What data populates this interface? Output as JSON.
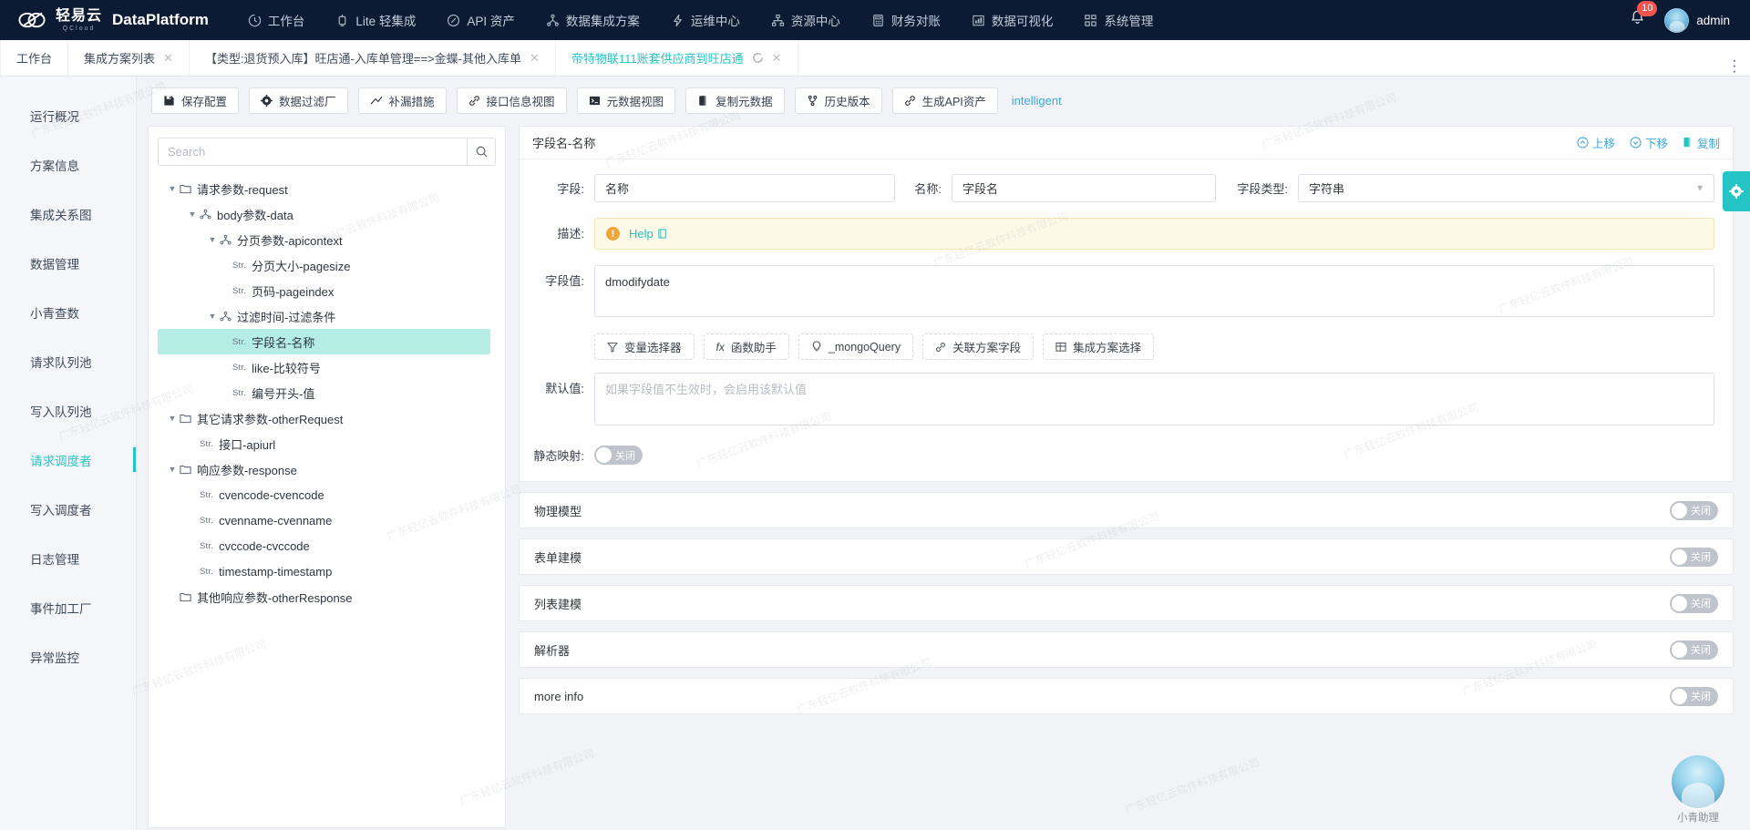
{
  "topnav": {
    "brand_cn": "轻易云",
    "brand_cn_sub": "QCloud",
    "brand_en": "DataPlatform",
    "items": [
      {
        "label": "工作台",
        "icon": "clock-icon"
      },
      {
        "label": "Lite 轻集成",
        "icon": "lite-icon"
      },
      {
        "label": "API 资产",
        "icon": "compass-icon"
      },
      {
        "label": "数据集成方案",
        "icon": "sitemap-icon"
      },
      {
        "label": "运维中心",
        "icon": "lightning-icon"
      },
      {
        "label": "资源中心",
        "icon": "org-icon"
      },
      {
        "label": "财务对账",
        "icon": "calculator-icon"
      },
      {
        "label": "数据可视化",
        "icon": "chart-icon"
      },
      {
        "label": "系统管理",
        "icon": "grid-icon"
      }
    ],
    "notification_count": "10",
    "username": "admin"
  },
  "tabbar": {
    "tabs": [
      {
        "label": "工作台",
        "closable": false,
        "active": false
      },
      {
        "label": "集成方案列表",
        "closable": true,
        "active": false
      },
      {
        "label": "【类型:退货预入库】旺店通-入库单管理==>金蝶-其他入库单",
        "closable": true,
        "active": false
      },
      {
        "label": "帝特物联111账套供应商到旺店通",
        "closable": true,
        "active": true,
        "reloadable": true
      }
    ],
    "more_icon": "more-vertical-icon"
  },
  "rail": {
    "items": [
      {
        "label": "运行概况",
        "active": false
      },
      {
        "label": "方案信息",
        "active": false
      },
      {
        "label": "集成关系图",
        "active": false
      },
      {
        "label": "数据管理",
        "active": false
      },
      {
        "label": "小青查数",
        "active": false
      },
      {
        "label": "请求队列池",
        "active": false
      },
      {
        "label": "写入队列池",
        "active": false
      },
      {
        "label": "请求调度者",
        "active": true
      },
      {
        "label": "写入调度者",
        "active": false
      },
      {
        "label": "日志管理",
        "active": false
      },
      {
        "label": "事件加工厂",
        "active": false
      },
      {
        "label": "异常监控",
        "active": false
      }
    ]
  },
  "toolbar": {
    "buttons": [
      {
        "label": "保存配置",
        "icon": "save-icon"
      },
      {
        "label": "数据过滤厂",
        "icon": "gear-icon"
      },
      {
        "label": "补漏措施",
        "icon": "trend-icon"
      },
      {
        "label": "接口信息视图",
        "icon": "link-icon"
      },
      {
        "label": "元数据视图",
        "icon": "terminal-icon"
      },
      {
        "label": "复制元数据",
        "icon": "copy-icon"
      },
      {
        "label": "历史版本",
        "icon": "branch-icon"
      },
      {
        "label": "生成API资产",
        "icon": "link-icon"
      }
    ],
    "link_label": "intelligent"
  },
  "tree": {
    "search_placeholder": "Search",
    "search_value": "",
    "search_icon": "search-icon",
    "nodes": [
      {
        "label": "请求参数-request",
        "depth": 0,
        "caret": "down",
        "icon": "folder-icon",
        "tag": "",
        "selected": false
      },
      {
        "label": "body参数-data",
        "depth": 1,
        "caret": "down",
        "icon": "node-icon",
        "tag": "",
        "selected": false
      },
      {
        "label": "分页参数-apicontext",
        "depth": 2,
        "caret": "down",
        "icon": "node-icon",
        "tag": "",
        "selected": false
      },
      {
        "label": "分页大小-pagesize",
        "depth": 3,
        "caret": "none",
        "icon": "",
        "tag": "Str.",
        "selected": false
      },
      {
        "label": "页码-pageindex",
        "depth": 3,
        "caret": "none",
        "icon": "",
        "tag": "Str.",
        "selected": false
      },
      {
        "label": "过滤时间-过滤条件",
        "depth": 2,
        "caret": "down",
        "icon": "node-icon",
        "tag": "",
        "selected": false
      },
      {
        "label": "字段名-名称",
        "depth": 3,
        "caret": "none",
        "icon": "",
        "tag": "Str.",
        "selected": true
      },
      {
        "label": "like-比较符号",
        "depth": 3,
        "caret": "none",
        "icon": "",
        "tag": "Str.",
        "selected": false
      },
      {
        "label": "编号开头-值",
        "depth": 3,
        "caret": "none",
        "icon": "",
        "tag": "Str.",
        "selected": false
      },
      {
        "label": "其它请求参数-otherRequest",
        "depth": 0,
        "caret": "down",
        "icon": "folder-icon",
        "tag": "",
        "selected": false
      },
      {
        "label": "接口-apiurl",
        "depth": 1,
        "caret": "none",
        "icon": "",
        "tag": "Str.",
        "selected": false
      },
      {
        "label": "响应参数-response",
        "depth": 0,
        "caret": "down",
        "icon": "folder-icon",
        "tag": "",
        "selected": false
      },
      {
        "label": "cvencode-cvencode",
        "depth": 1,
        "caret": "none",
        "icon": "",
        "tag": "Str.",
        "selected": false
      },
      {
        "label": "cvenname-cvenname",
        "depth": 1,
        "caret": "none",
        "icon": "",
        "tag": "Str.",
        "selected": false
      },
      {
        "label": "cvccode-cvccode",
        "depth": 1,
        "caret": "none",
        "icon": "",
        "tag": "Str.",
        "selected": false
      },
      {
        "label": "timestamp-timestamp",
        "depth": 1,
        "caret": "none",
        "icon": "",
        "tag": "Str.",
        "selected": false
      },
      {
        "label": "其他响应参数-otherResponse",
        "depth": 0,
        "caret": "none",
        "icon": "folder-icon",
        "tag": "",
        "selected": false
      }
    ]
  },
  "detail": {
    "title": "字段名-名称",
    "actions": [
      {
        "label": "上移",
        "icon": "arrow-up-circle-icon"
      },
      {
        "label": "下移",
        "icon": "arrow-down-circle-icon"
      },
      {
        "label": "复制",
        "icon": "copy-icon"
      }
    ],
    "field_label": "字段:",
    "field_value": "名称",
    "name_label": "名称:",
    "name_value": "字段名",
    "type_label": "字段类型:",
    "type_value": "字符串",
    "desc_label": "描述:",
    "desc_help": "Help",
    "desc_help_icon": "external-link-icon",
    "desc_warn_icon": "warning-icon",
    "value_label": "字段值:",
    "value_text": "dmodifydate",
    "chips": [
      {
        "label": "变量选择器",
        "icon": "filter-icon"
      },
      {
        "label": "函数助手",
        "icon": "fx-icon"
      },
      {
        "label": "_mongoQuery",
        "icon": "bulb-icon"
      },
      {
        "label": "关联方案字段",
        "icon": "link-icon"
      },
      {
        "label": "集成方案选择",
        "icon": "table-icon"
      }
    ],
    "default_label": "默认值:",
    "default_placeholder": "如果字段值不生效时，会启用该默认值",
    "default_value": "",
    "static_map_label": "静态映射:",
    "switch_off_text": "关闭",
    "sections": [
      {
        "label": "物理模型",
        "state": "关闭"
      },
      {
        "label": "表单建模",
        "state": "关闭"
      },
      {
        "label": "列表建模",
        "state": "关闭"
      },
      {
        "label": "解析器",
        "state": "关闭"
      },
      {
        "label": "more info",
        "state": "关闭"
      }
    ]
  },
  "side_gear_icon": "settings-gear-icon",
  "assistant": {
    "label": "小青助理"
  },
  "watermark_text": "广东轻亿云软件科技有限公司",
  "colors": {
    "accent": "#25c5c5",
    "nav_bg": "#0c1a33",
    "link": "#3aa9d8",
    "badge": "#f5544e"
  }
}
